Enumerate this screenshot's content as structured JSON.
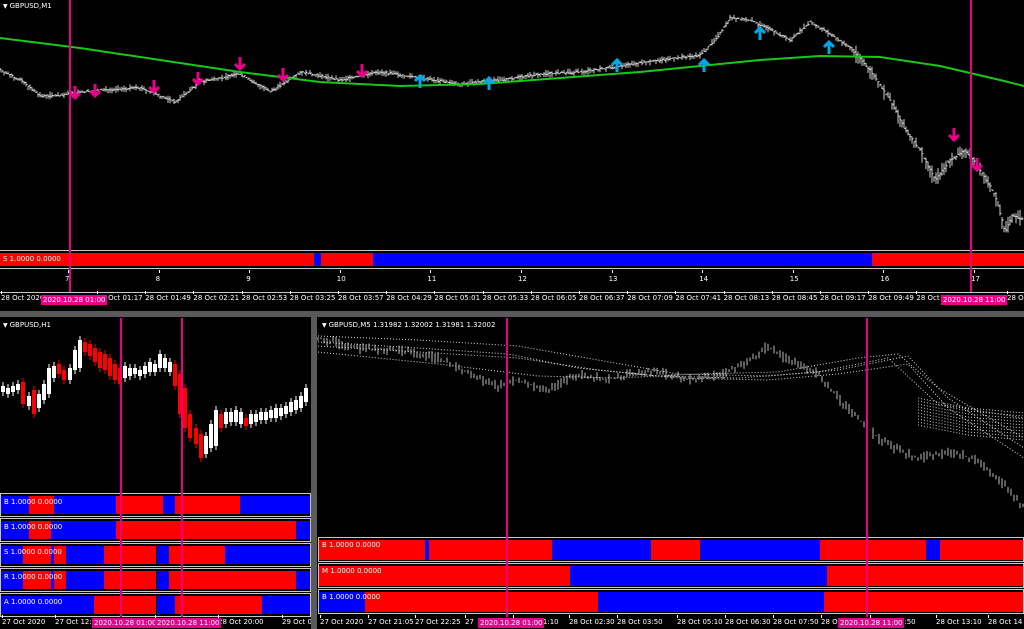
{
  "colors": {
    "bull": "#ff0000",
    "bear": "#0000ff",
    "ma": "#18c818",
    "vline": "#e8008a",
    "up_arrow": "#00a8e8",
    "down_arrow": "#e8008a",
    "price": "#d0d0d0"
  },
  "icons": {
    "collapse": "triangle-down-icon",
    "up": "up-arrow-icon",
    "down": "down-arrow-icon"
  },
  "top_window": {
    "title": "GBPUSD,M1",
    "indicator_label": "S 1.0000 0.0000",
    "number_scale": [
      "7",
      "8",
      "9",
      "10",
      "11",
      "12",
      "13",
      "14",
      "15",
      "16",
      "17"
    ],
    "time_labels": [
      "28 Oct 2020",
      "28 Oct 01:17",
      "28 Oct 01:49",
      "28 Oct 02:21",
      "28 Oct 02:53",
      "28 Oct 03:25",
      "28 Oct 03:57",
      "28 Oct 04:29",
      "28 Oct 05:01",
      "28 Oct 05:33",
      "28 Oct 06:05",
      "28 Oct 06:37",
      "28 Oct 07:09",
      "28 Oct 07:41",
      "28 Oct 08:13",
      "28 Oct 08:45",
      "28 Oct 09:17",
      "28 Oct 09:49",
      "28 Oct 1(",
      "28 Oct"
    ],
    "marker_labels": [
      "2020.10.28 01:00",
      "2020.10.28 11:00"
    ],
    "segments": [
      {
        "c": "bull",
        "from": 0.0,
        "to": 0.307
      },
      {
        "c": "bear",
        "from": 0.307,
        "to": 0.313
      },
      {
        "c": "bull",
        "from": 0.313,
        "to": 0.364
      },
      {
        "c": "bear",
        "from": 0.364,
        "to": 0.852
      },
      {
        "c": "bull",
        "from": 0.852,
        "to": 1.0
      }
    ]
  },
  "h1_window": {
    "title": "GBPUSD,H1",
    "time_labels": [
      "27 Oct 2020",
      "27 Oct 12:00",
      "28 Oct 12:00",
      "28 Oct 20:00",
      "29 Oct 0("
    ],
    "marker_labels": [
      "2020.10.28 01:00",
      "2020.10.28 11:00"
    ],
    "rows": [
      {
        "label": "B 1.0000 0.0000",
        "segments": [
          {
            "c": "bear",
            "from": 0,
            "to": 0.09
          },
          {
            "c": "bull",
            "from": 0.09,
            "to": 0.17
          },
          {
            "c": "bear",
            "from": 0.17,
            "to": 0.37
          },
          {
            "c": "bull",
            "from": 0.37,
            "to": 0.52
          },
          {
            "c": "bear",
            "from": 0.52,
            "to": 0.56
          },
          {
            "c": "bull",
            "from": 0.56,
            "to": 0.77
          },
          {
            "c": "bear",
            "from": 0.77,
            "to": 1
          }
        ]
      },
      {
        "label": "B 1.0000 0.0000",
        "segments": [
          {
            "c": "bear",
            "from": 0,
            "to": 0.09
          },
          {
            "c": "bull",
            "from": 0.09,
            "to": 0.16
          },
          {
            "c": "bear",
            "from": 0.16,
            "to": 0.37
          },
          {
            "c": "bull",
            "from": 0.37,
            "to": 0.95
          },
          {
            "c": "bear",
            "from": 0.95,
            "to": 1
          }
        ]
      },
      {
        "label": "S 1.0000 0.0000",
        "segments": [
          {
            "c": "bear",
            "from": 0,
            "to": 0.07
          },
          {
            "c": "bull",
            "from": 0.07,
            "to": 0.16
          },
          {
            "c": "bear",
            "from": 0.16,
            "to": 0.17
          },
          {
            "c": "bull",
            "from": 0.17,
            "to": 0.21
          },
          {
            "c": "bear",
            "from": 0.21,
            "to": 0.33
          },
          {
            "c": "bull",
            "from": 0.33,
            "to": 0.5
          },
          {
            "c": "bear",
            "from": 0.5,
            "to": 0.54
          },
          {
            "c": "bull",
            "from": 0.54,
            "to": 0.72
          },
          {
            "c": "bear",
            "from": 0.72,
            "to": 1
          }
        ]
      },
      {
        "label": "R 1.0000 0.0000",
        "segments": [
          {
            "c": "bear",
            "from": 0,
            "to": 0.07
          },
          {
            "c": "bull",
            "from": 0.07,
            "to": 0.16
          },
          {
            "c": "bear",
            "from": 0.16,
            "to": 0.17
          },
          {
            "c": "bull",
            "from": 0.17,
            "to": 0.21
          },
          {
            "c": "bear",
            "from": 0.21,
            "to": 0.33
          },
          {
            "c": "bull",
            "from": 0.33,
            "to": 0.5
          },
          {
            "c": "bear",
            "from": 0.5,
            "to": 0.54
          },
          {
            "c": "bull",
            "from": 0.54,
            "to": 0.95
          },
          {
            "c": "bear",
            "from": 0.95,
            "to": 1
          }
        ]
      },
      {
        "label": "A 1.0000 0.0000",
        "segments": [
          {
            "c": "bear",
            "from": 0,
            "to": 0.3
          },
          {
            "c": "bull",
            "from": 0.3,
            "to": 0.5
          },
          {
            "c": "bear",
            "from": 0.5,
            "to": 0.56
          },
          {
            "c": "bull",
            "from": 0.56,
            "to": 0.84
          },
          {
            "c": "bear",
            "from": 0.84,
            "to": 1
          }
        ]
      }
    ]
  },
  "m5_window": {
    "title": "GBPUSD,M5  1.31982 1.32002 1.31981 1.32002",
    "time_labels": [
      "27 Oct 2020",
      "27 Oct 21:05",
      "27 Oct 22:25",
      "27",
      "28 Oct 01:10",
      "28 Oct 02:30",
      "28 Oct 03:50",
      "28 Oct 05:10",
      "28 Oct 06:30",
      "28 Oct 07:50",
      "28 Oct 09:1(",
      "28 Oct 11:50",
      "28 Oct 13:10",
      "28 Oct 14"
    ],
    "marker_labels": [
      "2020.10.28 01:00",
      "2020.10.28 11:00"
    ],
    "rows": [
      {
        "label": "B 1.0000 0.0000",
        "segments": [
          {
            "c": "bull",
            "from": 0,
            "to": 0.15
          },
          {
            "c": "bear",
            "from": 0.15,
            "to": 0.156
          },
          {
            "c": "bull",
            "from": 0.156,
            "to": 0.33
          },
          {
            "c": "bear",
            "from": 0.33,
            "to": 0.47
          },
          {
            "c": "bull",
            "from": 0.47,
            "to": 0.54
          },
          {
            "c": "bear",
            "from": 0.54,
            "to": 0.71
          },
          {
            "c": "bull",
            "from": 0.71,
            "to": 0.86
          },
          {
            "c": "bear",
            "from": 0.86,
            "to": 0.88
          },
          {
            "c": "bull",
            "from": 0.88,
            "to": 1
          }
        ]
      },
      {
        "label": "M 1.0000 0.0000",
        "segments": [
          {
            "c": "bull",
            "from": 0,
            "to": 0.355
          },
          {
            "c": "bear",
            "from": 0.355,
            "to": 0.72
          },
          {
            "c": "bull",
            "from": 0.72,
            "to": 1
          }
        ]
      },
      {
        "label": "B 1.0000 0.0000",
        "segments": [
          {
            "c": "bear",
            "from": 0,
            "to": 0.065
          },
          {
            "c": "bull",
            "from": 0.065,
            "to": 0.395
          },
          {
            "c": "bear",
            "from": 0.395,
            "to": 0.715
          },
          {
            "c": "bull",
            "from": 0.715,
            "to": 1
          }
        ]
      }
    ]
  }
}
